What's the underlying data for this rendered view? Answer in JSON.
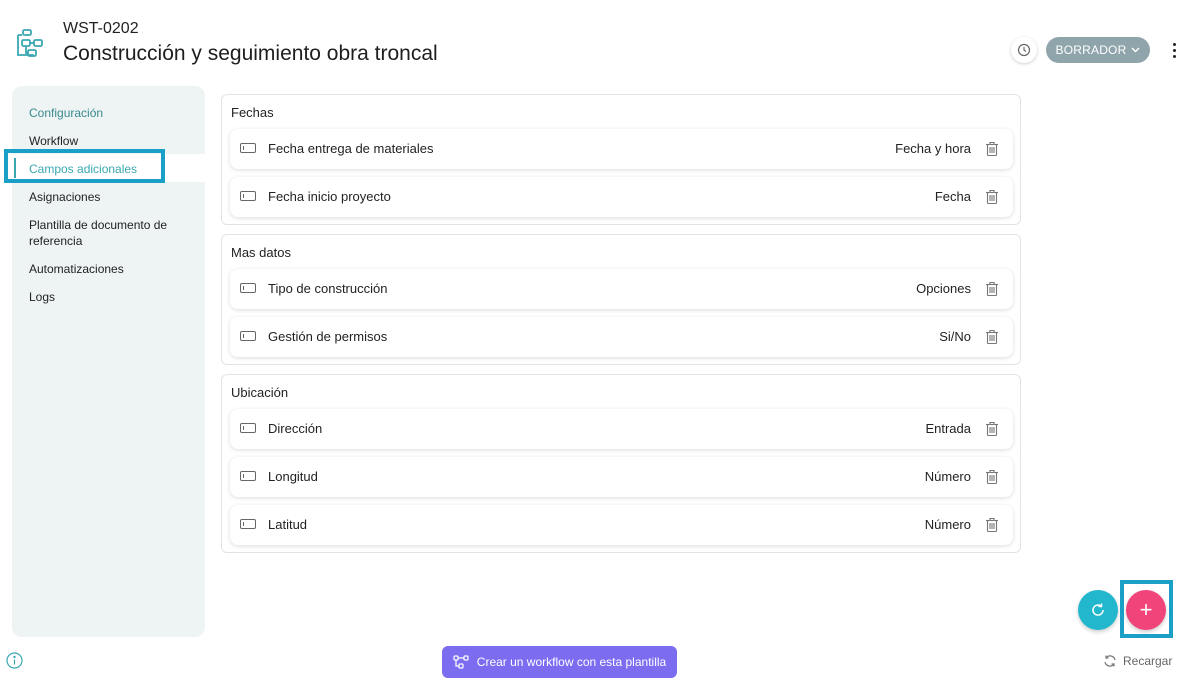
{
  "header": {
    "code": "WST-0202",
    "title": "Construcción y seguimiento obra troncal",
    "status": "BORRADOR",
    "icons": {
      "app": "workflow-template-icon",
      "history": "clock-icon",
      "more": "kebab-menu-icon",
      "status_caret": "chevron-down-icon"
    }
  },
  "sidebar": {
    "items": [
      {
        "label": "Configuración",
        "state": "section"
      },
      {
        "label": "Workflow"
      },
      {
        "label": "Campos adicionales",
        "state": "active"
      },
      {
        "label": "Asignaciones"
      },
      {
        "label": "Plantilla de documento de referencia"
      },
      {
        "label": "Automatizaciones"
      },
      {
        "label": "Logs"
      }
    ]
  },
  "sections": [
    {
      "title": "Fechas",
      "fields": [
        {
          "name": "Fecha entrega de materiales",
          "type": "Fecha y hora"
        },
        {
          "name": "Fecha inicio proyecto",
          "type": "Fecha"
        }
      ]
    },
    {
      "title": "Mas datos",
      "fields": [
        {
          "name": "Tipo de construcción",
          "type": "Opciones"
        },
        {
          "name": "Gestión de permisos",
          "type": "Si/No"
        }
      ]
    },
    {
      "title": "Ubicación",
      "fields": [
        {
          "name": "Dirección",
          "type": "Entrada"
        },
        {
          "name": "Longitud",
          "type": "Número"
        },
        {
          "name": "Latitud",
          "type": "Número"
        }
      ]
    }
  ],
  "footer": {
    "create_button": "Crear un workflow con esta plantilla",
    "reload": "Recargar",
    "add_symbol": "+"
  },
  "colors": {
    "accent": "#3aa7b3",
    "status_bg": "#8fa5ab",
    "create_btn": "#7b6cf0",
    "fab_refresh": "#22b7cc",
    "fab_add": "#f0447a",
    "highlight": "#1aa0c6"
  }
}
